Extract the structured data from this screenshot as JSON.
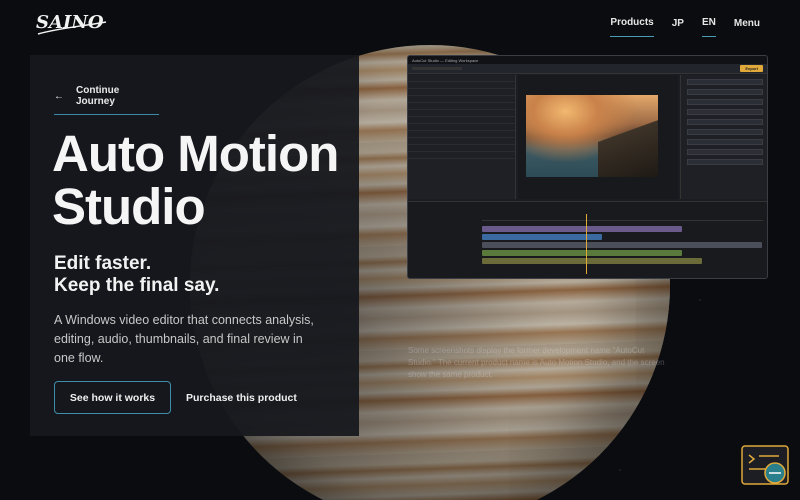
{
  "header": {
    "logo_text": "SAINO",
    "nav": {
      "products": "Products",
      "jp": "JP",
      "en": "EN",
      "menu": "Menu"
    }
  },
  "hero": {
    "back_label": "Continue Journey",
    "title": "Auto Motion Studio",
    "subtitle_line1": "Edit faster.",
    "subtitle_line2": "Keep the final say.",
    "description": "A Windows video editor that connects analysis, editing, audio, thumbnails, and final review in one flow.",
    "primary_button": "See how it works",
    "secondary_button": "Purchase this product"
  },
  "screenshot": {
    "titlebar": "AutoCut Studio — Editing Workspace",
    "export_label": "Export",
    "caption": "Some screenshots display the former development name \"AutoCut Studio.\" The current product name is Auto Motion Studio, and the screen show the same product."
  },
  "colors": {
    "accent": "#3f8ea9",
    "panel": "#16181e",
    "export": "#e0a93a"
  },
  "icons": {
    "back": "arrow-left-icon",
    "menu": "hamburger-icon",
    "help": "chat-help-icon"
  }
}
